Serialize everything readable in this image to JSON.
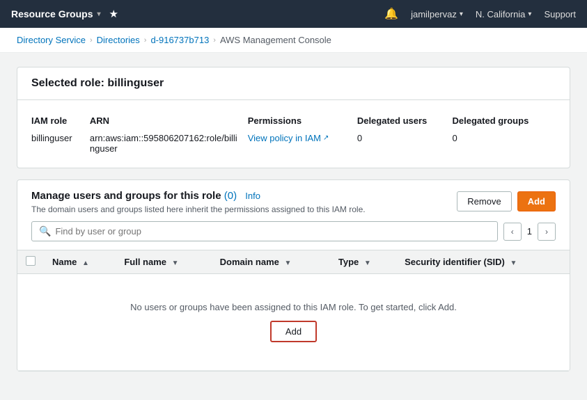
{
  "topNav": {
    "title": "Resource Groups",
    "chevron": "▾",
    "bookmark_icon": "★",
    "bell_icon": "🔔",
    "user": "jamilpervaz",
    "region": "N. California",
    "support": "Support"
  },
  "breadcrumb": {
    "items": [
      {
        "label": "Directory Service",
        "href": "#"
      },
      {
        "label": "Directories",
        "href": "#"
      },
      {
        "label": "d-916737b713",
        "href": "#"
      },
      {
        "label": "AWS Management Console",
        "current": true
      }
    ]
  },
  "roleCard": {
    "title": "Selected role: billinguser",
    "table": {
      "headers": [
        "IAM role",
        "ARN",
        "Permissions",
        "Delegated users",
        "Delegated groups"
      ],
      "row": {
        "iam_role": "billinguser",
        "arn": "arn:aws:iam::595806207162:role/billinguser",
        "permissions_label": "View policy in IAM",
        "external_icon": "↗",
        "delegated_users": "0",
        "delegated_groups": "0"
      }
    }
  },
  "manageCard": {
    "title": "Manage users and groups for this role",
    "count": "(0)",
    "info_link": "Info",
    "subtitle": "The domain users and groups listed here inherit the permissions assigned to this IAM role.",
    "remove_btn": "Remove",
    "add_btn": "Add",
    "search": {
      "placeholder": "Find by user or group"
    },
    "pagination": {
      "prev_icon": "‹",
      "page": "1",
      "next_icon": "›"
    },
    "table": {
      "headers": [
        {
          "label": "Name",
          "sort": "▲"
        },
        {
          "label": "Full name",
          "sort": "▼"
        },
        {
          "label": "Domain name",
          "sort": "▼"
        },
        {
          "label": "Type",
          "sort": "▼"
        },
        {
          "label": "Security identifier (SID)",
          "sort": "▼"
        }
      ]
    },
    "empty_message": "No users or groups have been assigned to this IAM role. To get started, click Add.",
    "empty_add_btn": "Add"
  }
}
